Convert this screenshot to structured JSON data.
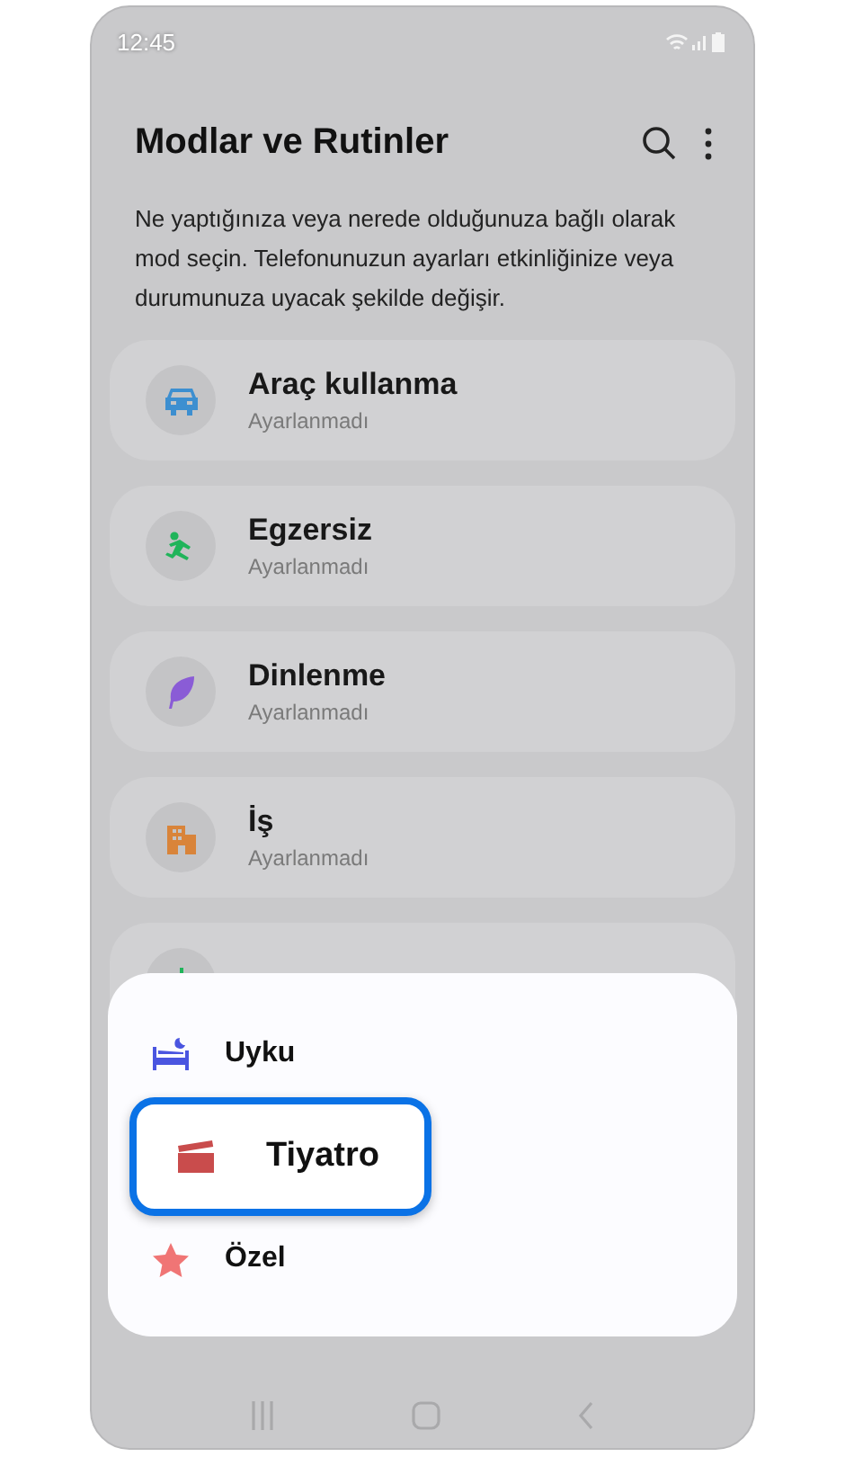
{
  "status_bar": {
    "time": "12:45"
  },
  "header": {
    "title": "Modlar ve Rutinler"
  },
  "description": "Ne yaptığınıza veya nerede olduğunuza bağlı olarak mod seçin. Telefonunuzun ayarları etkinliğinize veya durumunuza uyacak şekilde değişir.",
  "modes": [
    {
      "kind": "car",
      "title": "Araç kullanma",
      "subtitle": "Ayarlanmadı"
    },
    {
      "kind": "exercise",
      "title": "Egzersiz",
      "subtitle": "Ayarlanmadı"
    },
    {
      "kind": "leaf",
      "title": "Dinlenme",
      "subtitle": "Ayarlanmadı"
    },
    {
      "kind": "building",
      "title": "İş",
      "subtitle": "Ayarlanmadı"
    },
    {
      "kind": "add"
    }
  ],
  "popup": {
    "items": [
      {
        "kind": "bed",
        "label": "Uyku",
        "selected": false
      },
      {
        "kind": "clapper",
        "label": "Tiyatro",
        "selected": true
      },
      {
        "kind": "star",
        "label": "Özel",
        "selected": false
      }
    ]
  }
}
